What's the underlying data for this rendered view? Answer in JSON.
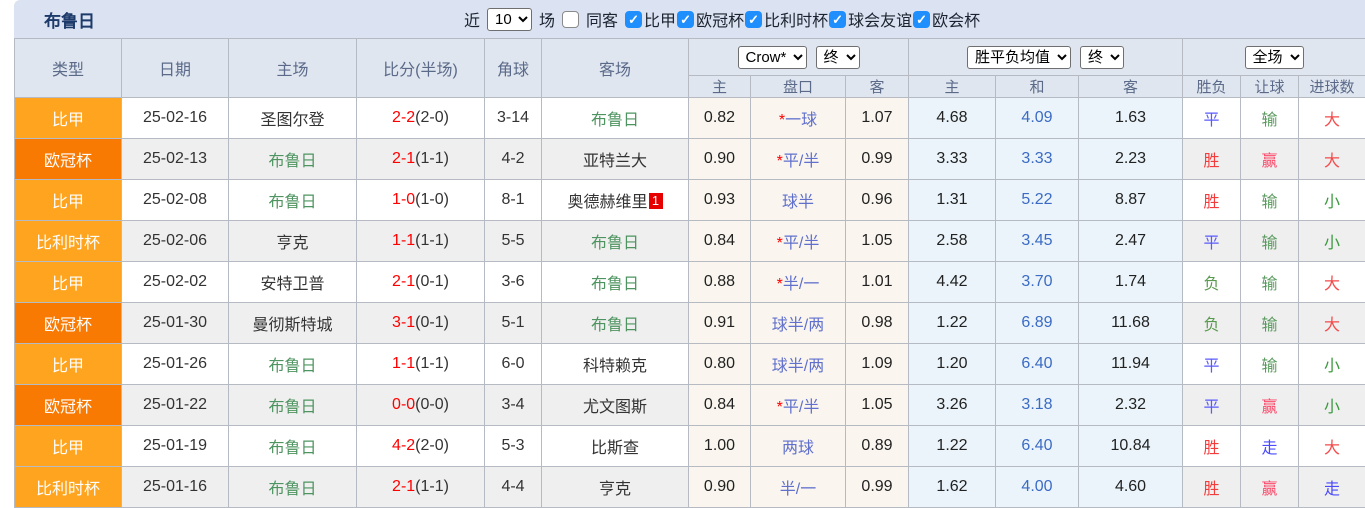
{
  "header": {
    "title": "布鲁日",
    "filter": {
      "recent_label": "近",
      "recent_value": "10",
      "matches_label": "场",
      "same_venue_label": "同客",
      "same_venue_checked": false,
      "leagues": [
        {
          "label": "比甲",
          "checked": true
        },
        {
          "label": "欧冠杯",
          "checked": true
        },
        {
          "label": "比利时杯",
          "checked": true
        },
        {
          "label": "球会友谊",
          "checked": true
        },
        {
          "label": "欧会杯",
          "checked": true
        }
      ]
    }
  },
  "table": {
    "columns": {
      "type": "类型",
      "date": "日期",
      "home": "主场",
      "score": "比分(半场)",
      "corner": "角球",
      "away": "客场",
      "odds_home": "主",
      "odds_handicap": "盘口",
      "odds_away": "客",
      "avg_home": "主",
      "avg_draw": "和",
      "avg_away": "客",
      "outcome": "胜负",
      "handicap_result": "让球",
      "goals": "进球数"
    },
    "selectors": {
      "company": "Crow*",
      "company_state": "终",
      "avg": "胜平负均值",
      "avg_state": "终",
      "scope": "全场"
    },
    "rows": [
      {
        "league": "比甲",
        "date": "25-02-16",
        "home": "圣图尔登",
        "score_ft": "2-2",
        "score_ht": "(2-0)",
        "corner": "3-14",
        "away": "布鲁日",
        "away_badge": "",
        "odds_home": "0.82",
        "handicap_star": "*",
        "handicap": "一球",
        "odds_away": "1.07",
        "avg_home": "4.68",
        "avg_draw": "4.09",
        "avg_away": "1.63",
        "outcome": "平",
        "let_result": "输",
        "goals": "大"
      },
      {
        "league": "欧冠杯",
        "date": "25-02-13",
        "home": "布鲁日",
        "score_ft": "2-1",
        "score_ht": "(1-1)",
        "corner": "4-2",
        "away": "亚特兰大",
        "away_badge": "",
        "odds_home": "0.90",
        "handicap_star": "*",
        "handicap": "平/半",
        "odds_away": "0.99",
        "avg_home": "3.33",
        "avg_draw": "3.33",
        "avg_away": "2.23",
        "outcome": "胜",
        "let_result": "赢",
        "goals": "大"
      },
      {
        "league": "比甲",
        "date": "25-02-08",
        "home": "布鲁日",
        "score_ft": "1-0",
        "score_ht": "(1-0)",
        "corner": "8-1",
        "away": "奥德赫维里",
        "away_badge": "1",
        "odds_home": "0.93",
        "handicap_star": "",
        "handicap": "球半",
        "odds_away": "0.96",
        "avg_home": "1.31",
        "avg_draw": "5.22",
        "avg_away": "8.87",
        "outcome": "胜",
        "let_result": "输",
        "goals": "小"
      },
      {
        "league": "比利时杯",
        "date": "25-02-06",
        "home": "亨克",
        "score_ft": "1-1",
        "score_ht": "(1-1)",
        "corner": "5-5",
        "away": "布鲁日",
        "away_badge": "",
        "odds_home": "0.84",
        "handicap_star": "*",
        "handicap": "平/半",
        "odds_away": "1.05",
        "avg_home": "2.58",
        "avg_draw": "3.45",
        "avg_away": "2.47",
        "outcome": "平",
        "let_result": "输",
        "goals": "小"
      },
      {
        "league": "比甲",
        "date": "25-02-02",
        "home": "安特卫普",
        "score_ft": "2-1",
        "score_ht": "(0-1)",
        "corner": "3-6",
        "away": "布鲁日",
        "away_badge": "",
        "odds_home": "0.88",
        "handicap_star": "*",
        "handicap": "半/一",
        "odds_away": "1.01",
        "avg_home": "4.42",
        "avg_draw": "3.70",
        "avg_away": "1.74",
        "outcome": "负",
        "let_result": "输",
        "goals": "大"
      },
      {
        "league": "欧冠杯",
        "date": "25-01-30",
        "home": "曼彻斯特城",
        "score_ft": "3-1",
        "score_ht": "(0-1)",
        "corner": "5-1",
        "away": "布鲁日",
        "away_badge": "",
        "odds_home": "0.91",
        "handicap_star": "",
        "handicap": "球半/两",
        "odds_away": "0.98",
        "avg_home": "1.22",
        "avg_draw": "6.89",
        "avg_away": "11.68",
        "outcome": "负",
        "let_result": "输",
        "goals": "大"
      },
      {
        "league": "比甲",
        "date": "25-01-26",
        "home": "布鲁日",
        "score_ft": "1-1",
        "score_ht": "(1-1)",
        "corner": "6-0",
        "away": "科特赖克",
        "away_badge": "",
        "odds_home": "0.80",
        "handicap_star": "",
        "handicap": "球半/两",
        "odds_away": "1.09",
        "avg_home": "1.20",
        "avg_draw": "6.40",
        "avg_away": "11.94",
        "outcome": "平",
        "let_result": "输",
        "goals": "小"
      },
      {
        "league": "欧冠杯",
        "date": "25-01-22",
        "home": "布鲁日",
        "score_ft": "0-0",
        "score_ht": "(0-0)",
        "corner": "3-4",
        "away": "尤文图斯",
        "away_badge": "",
        "odds_home": "0.84",
        "handicap_star": "*",
        "handicap": "平/半",
        "odds_away": "1.05",
        "avg_home": "3.26",
        "avg_draw": "3.18",
        "avg_away": "2.32",
        "outcome": "平",
        "let_result": "赢",
        "goals": "小"
      },
      {
        "league": "比甲",
        "date": "25-01-19",
        "home": "布鲁日",
        "score_ft": "4-2",
        "score_ht": "(2-0)",
        "corner": "5-3",
        "away": "比斯查",
        "away_badge": "",
        "odds_home": "1.00",
        "handicap_star": "",
        "handicap": "两球",
        "odds_away": "0.89",
        "avg_home": "1.22",
        "avg_draw": "6.40",
        "avg_away": "10.84",
        "outcome": "胜",
        "let_result": "走",
        "goals": "大"
      },
      {
        "league": "比利时杯",
        "date": "25-01-16",
        "home": "布鲁日",
        "score_ft": "2-1",
        "score_ht": "(1-1)",
        "corner": "4-4",
        "away": "亨克",
        "away_badge": "",
        "odds_home": "0.90",
        "handicap_star": "",
        "handicap": "半/一",
        "odds_away": "0.99",
        "avg_home": "1.62",
        "avg_draw": "4.00",
        "avg_away": "4.60",
        "outcome": "胜",
        "let_result": "赢",
        "goals": "走"
      }
    ]
  },
  "colors": {
    "topbar_bg": "#dbe2f1",
    "header_bg": "#e0e6f0",
    "checkbox_blue": "#1e8ffd",
    "subject_team_green": "#4e9460",
    "score_red": "#ff0000",
    "handicap_blue": "#6070cc",
    "avg_draw_blue": "#3b6bc5",
    "stripe_gray": "#efefef",
    "odds_bg_cream": "#faf6ef",
    "avg_bg_cyan": "#eaf4fa",
    "league": {
      "比甲": "#ffa41f",
      "欧冠杯": "#f97a03",
      "比利时杯": "#ffa41f",
      "球会友谊": "#ffa41f",
      "欧会杯": "#f97a03"
    },
    "result": {
      "胜": "#f43b3b",
      "负": "#5a9a4e",
      "平": "#5b5bfb",
      "赢": "#fb4b6b",
      "输": "#5a9a5e",
      "走": "#4b4bfb",
      "大": "#f44b4b",
      "小": "#3a9a3e"
    }
  }
}
